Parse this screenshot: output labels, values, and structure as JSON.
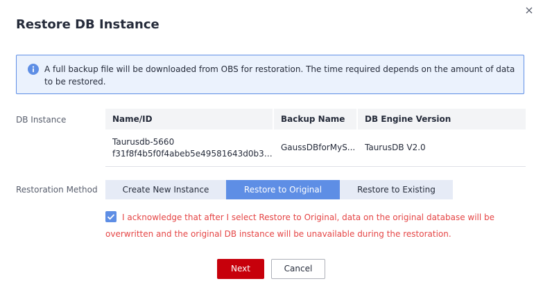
{
  "dialog": {
    "title": "Restore DB Instance",
    "close_icon": "close-icon"
  },
  "info": {
    "icon": "info-icon",
    "text": "A full backup file will be downloaded from OBS for restoration. The time required depends on the amount of data to be restored."
  },
  "db_instance": {
    "label": "DB Instance",
    "columns": [
      "Name/ID",
      "Backup Name",
      "DB Engine Version"
    ],
    "row": {
      "name": "Taurusdb-5660",
      "id": "f31f8f4b5f0f4abeb5e49581643d0b30in...",
      "backup_name": "GaussDBforMyS...",
      "engine_version": "TaurusDB V2.0"
    }
  },
  "restoration": {
    "label": "Restoration Method",
    "options": [
      "Create New Instance",
      "Restore to Original",
      "Restore to Existing"
    ],
    "selected": "Restore to Original"
  },
  "acknowledge": {
    "checked": true,
    "text": "I acknowledge that after I select Restore to Original, data on the original database will be overwritten and the original DB instance will be unavailable during the restoration."
  },
  "footer": {
    "next_label": "Next",
    "cancel_label": "Cancel"
  },
  "colors": {
    "accent": "#5e8ee5",
    "primary_button": "#c7000b",
    "warning_text": "#e54545",
    "info_background": "#ebf2fd"
  }
}
